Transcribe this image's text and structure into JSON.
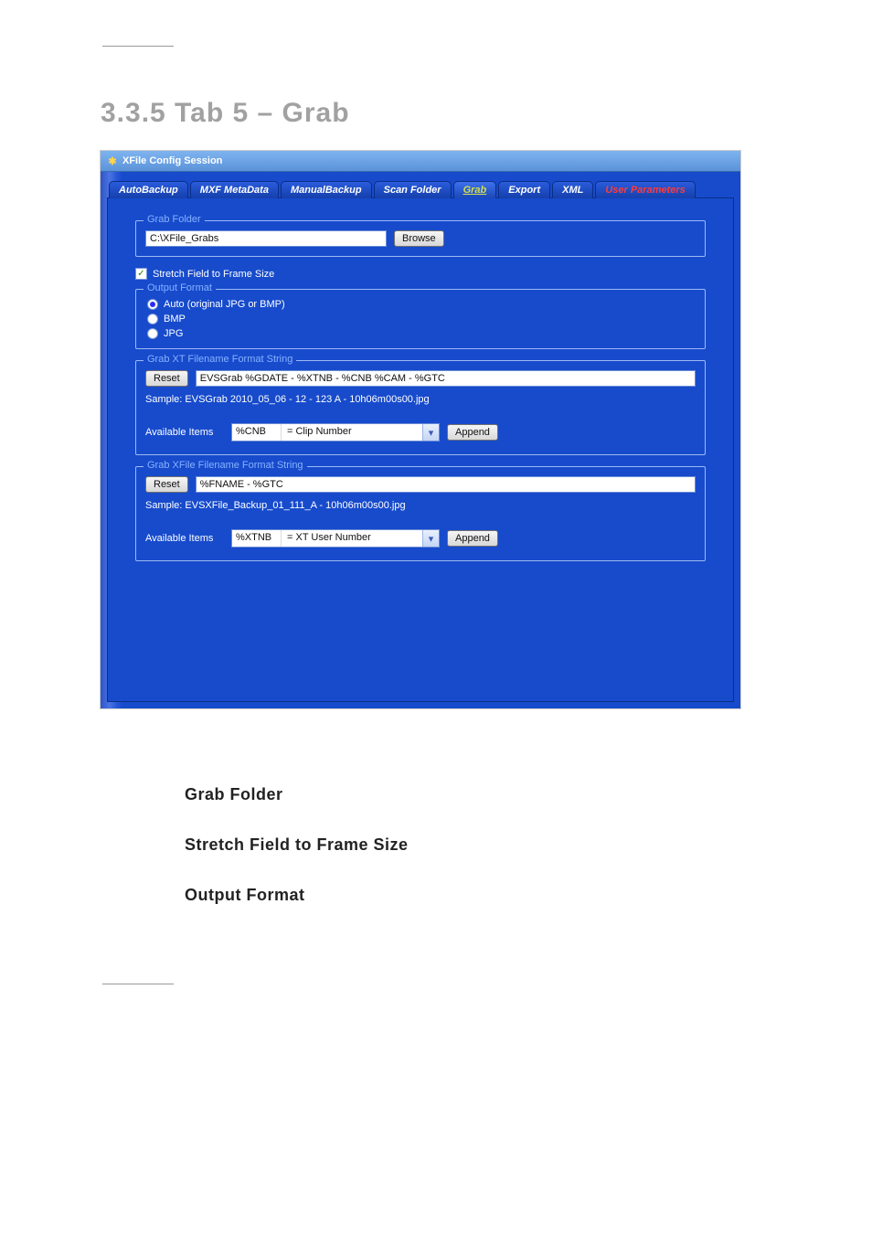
{
  "heading": "3.3.5  Tab 5 – Grab",
  "window": {
    "title": "XFile Config Session",
    "tabs": [
      "AutoBackup",
      "MXF MetaData",
      "ManualBackup",
      "Scan Folder",
      "Grab",
      "Export",
      "XML",
      "User Parameters"
    ],
    "active_tab_index": 4
  },
  "grab_folder": {
    "legend": "Grab Folder",
    "path": "C:\\XFile_Grabs",
    "browse": "Browse"
  },
  "stretch": {
    "checked": true,
    "label": "Stretch Field to Frame Size"
  },
  "output_format": {
    "legend": "Output Format",
    "options": [
      "Auto (original JPG or BMP)",
      "BMP",
      "JPG"
    ],
    "selected_index": 0
  },
  "xt_string": {
    "legend": "Grab XT Filename Format String",
    "reset": "Reset",
    "value": "EVSGrab %GDATE - %XTNB - %CNB %CAM - %GTC",
    "sample_label": "Sample: EVSGrab 2010_05_06 - 12 - 123 A - 10h06m00s00.jpg",
    "avail_label": "Available Items",
    "combo_code": "%CNB",
    "combo_desc": "= Clip Number",
    "append": "Append"
  },
  "xfile_string": {
    "legend": "Grab XFile Filename Format String",
    "reset": "Reset",
    "value": "%FNAME - %GTC",
    "sample_label": "Sample: EVSXFile_Backup_01_111_A - 10h06m00s00.jpg",
    "avail_label": "Available Items",
    "combo_code": "%XTNB",
    "combo_desc": "= XT User Number",
    "append": "Append"
  },
  "body": {
    "h1": "Grab Folder",
    "h2": "Stretch Field to Frame Size",
    "h3": "Output Format"
  }
}
